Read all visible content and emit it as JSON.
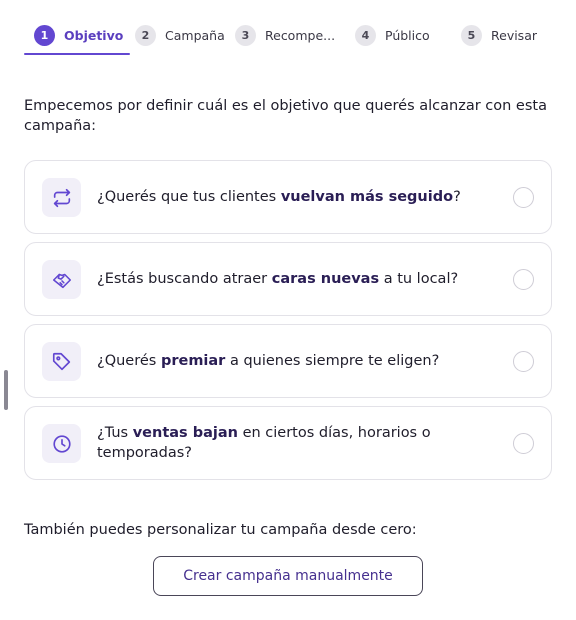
{
  "stepper": {
    "steps": [
      {
        "number": "1",
        "label": "Objetivo",
        "active": true
      },
      {
        "number": "2",
        "label": "Campaña"
      },
      {
        "number": "3",
        "label": "Recompe..."
      },
      {
        "number": "4",
        "label": "Público"
      },
      {
        "number": "5",
        "label": "Revisar"
      }
    ]
  },
  "intro": "Empecemos por definir cuál es el objetivo que querés alcanzar con esta campaña:",
  "options": [
    {
      "icon": "repeat-arrows-icon",
      "before": "¿Querés que tus clientes ",
      "bold": "vuelvan más seguido",
      "after": "?"
    },
    {
      "icon": "handshake-icon",
      "before": "¿Estás buscando atraer ",
      "bold": "caras nuevas",
      "after": " a tu local?"
    },
    {
      "icon": "tag-icon",
      "before": "¿Querés ",
      "bold": "premiar",
      "after": " a quienes siempre te eligen?"
    },
    {
      "icon": "clock-icon",
      "before": "¿Tus ",
      "bold": "ventas bajan",
      "after": " en ciertos días, horarios o temporadas?"
    }
  ],
  "custom": {
    "text": "También puedes personalizar tu campaña desde cero:",
    "button_label": "Crear campaña manualmente"
  },
  "colors": {
    "accent": "#6247d1",
    "icon_bg": "#f1eff8",
    "border": "#e3e2e8"
  }
}
